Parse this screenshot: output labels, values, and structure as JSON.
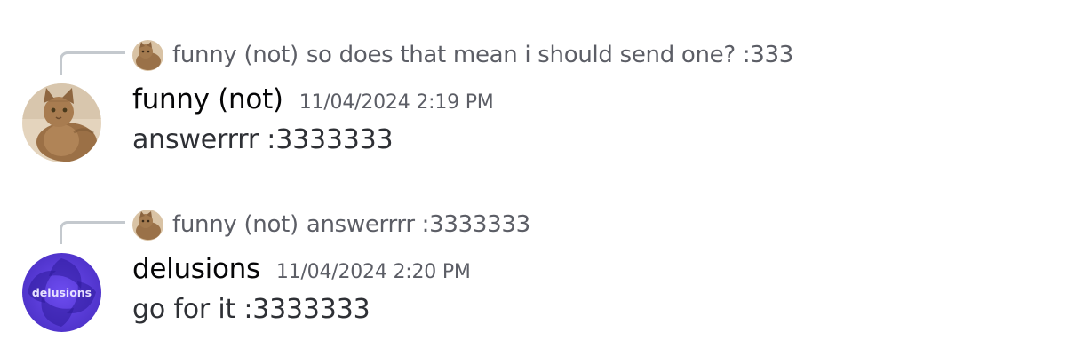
{
  "messages": [
    {
      "reply": {
        "author": "funny (not)",
        "content": "so does that mean i should send one? :333",
        "avatar_icon": "cat-avatar-icon"
      },
      "author": "funny (not)",
      "timestamp": "11/04/2024 2:19 PM",
      "content": "answerrrr :3333333",
      "avatar_icon": "cat-avatar-icon"
    },
    {
      "reply": {
        "author": "funny (not)",
        "content": "answerrrr :3333333",
        "avatar_icon": "cat-avatar-icon"
      },
      "author": "delusions",
      "timestamp": "11/04/2024 2:20 PM",
      "content": "go for it :3333333",
      "avatar_icon": "delusions-logo-avatar",
      "avatar_text": "delusions"
    }
  ],
  "colors": {
    "reply_spine": "#c4c9ce",
    "muted_text": "#5c5e66",
    "delusions_avatar": "#5b3fd6"
  }
}
